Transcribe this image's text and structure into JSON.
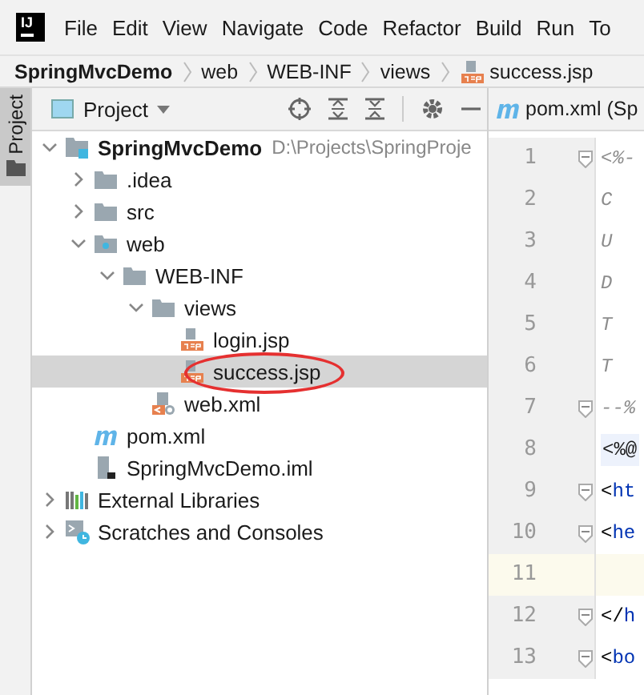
{
  "menu_bar": {
    "logo": "IJ",
    "items": [
      "File",
      "Edit",
      "View",
      "Navigate",
      "Code",
      "Refactor",
      "Build",
      "Run",
      "To"
    ]
  },
  "breadcrumb": [
    {
      "label": "SpringMvcDemo",
      "kind": "module"
    },
    {
      "label": "web",
      "kind": "folder"
    },
    {
      "label": "WEB-INF",
      "kind": "folder"
    },
    {
      "label": "views",
      "kind": "folder"
    },
    {
      "label": "success.jsp",
      "kind": "jsp"
    }
  ],
  "side_stripe": {
    "tabs": [
      {
        "label": "Project",
        "selected": true
      }
    ]
  },
  "project_panel": {
    "title": "Project",
    "tree": [
      {
        "label": "SpringMvcDemo",
        "path": "D:\\Projects\\SpringProje",
        "kind": "module",
        "expanded": true,
        "selected": false,
        "children": [
          {
            "label": ".idea",
            "kind": "folder",
            "expanded": false,
            "selected": false
          },
          {
            "label": "src",
            "kind": "folder",
            "expanded": false,
            "selected": false
          },
          {
            "label": "web",
            "kind": "webfolder",
            "expanded": true,
            "selected": false,
            "children": [
              {
                "label": "WEB-INF",
                "kind": "folder",
                "expanded": true,
                "selected": false,
                "children": [
                  {
                    "label": "views",
                    "kind": "folder",
                    "expanded": true,
                    "selected": false,
                    "children": [
                      {
                        "label": "login.jsp",
                        "kind": "jsp",
                        "selected": false
                      },
                      {
                        "label": "success.jsp",
                        "kind": "jsp",
                        "selected": true,
                        "circled": true
                      }
                    ]
                  },
                  {
                    "label": "web.xml",
                    "kind": "webxml",
                    "selected": false
                  }
                ]
              }
            ]
          },
          {
            "label": "pom.xml",
            "kind": "maven",
            "selected": false
          },
          {
            "label": "SpringMvcDemo.iml",
            "kind": "iml",
            "selected": false
          }
        ]
      },
      {
        "label": "External Libraries",
        "kind": "libraries",
        "expanded": false,
        "selected": false
      },
      {
        "label": "Scratches and Consoles",
        "kind": "scratches",
        "expanded": false,
        "selected": false
      }
    ]
  },
  "editor": {
    "tab": {
      "label": "pom.xml (Sp",
      "kind": "maven"
    },
    "lines": [
      {
        "number": "1",
        "kind": "comment",
        "text": "<%-",
        "fold": true
      },
      {
        "number": "2",
        "kind": "comment",
        "text": "C",
        "fold": false
      },
      {
        "number": "3",
        "kind": "comment",
        "text": "U",
        "fold": false
      },
      {
        "number": "4",
        "kind": "comment",
        "text": "D",
        "fold": false
      },
      {
        "number": "5",
        "kind": "comment",
        "text": "T",
        "fold": false
      },
      {
        "number": "6",
        "kind": "comment",
        "text": "T",
        "fold": false
      },
      {
        "number": "7",
        "kind": "comment",
        "text": "--%",
        "fold": true
      },
      {
        "number": "8",
        "kind": "directive",
        "text": "<%@",
        "fold": false
      },
      {
        "number": "9",
        "kind": "tag",
        "punct": "<",
        "text": "ht",
        "fold": true
      },
      {
        "number": "10",
        "kind": "tag",
        "punct": "<",
        "text": "he",
        "fold": true
      },
      {
        "number": "11",
        "kind": "blank",
        "fold": false,
        "current": true
      },
      {
        "number": "12",
        "kind": "tag",
        "punct": "</",
        "text": "h",
        "fold": true
      },
      {
        "number": "13",
        "kind": "tag",
        "punct": "<",
        "text": "bo",
        "fold": true
      }
    ]
  }
}
